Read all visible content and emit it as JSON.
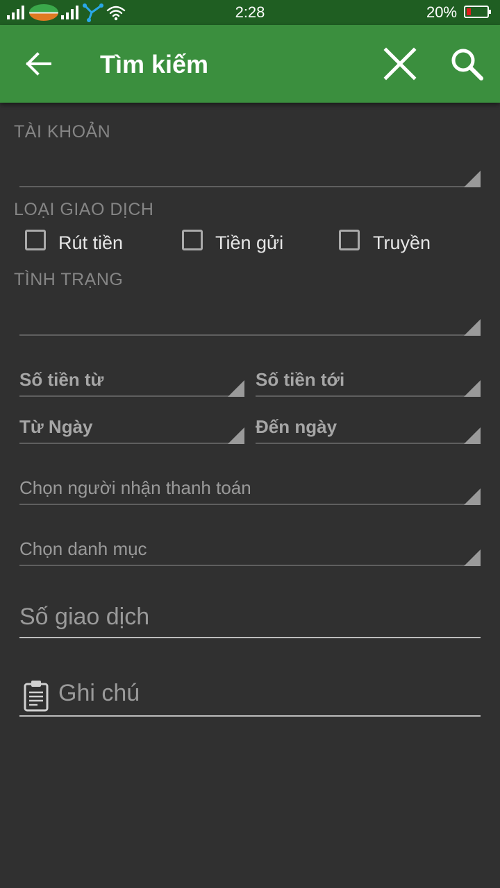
{
  "status_bar": {
    "time": "2:28",
    "battery_percent": "20%",
    "battery_level": 0.2,
    "icons": [
      "signal-icon",
      "carrier-logo",
      "signal-icon",
      "network-share-icon",
      "wifi-icon",
      "battery-icon"
    ]
  },
  "app_bar": {
    "title": "Tìm kiếm",
    "icons": [
      "back-arrow-icon",
      "close-icon",
      "search-icon"
    ],
    "background_color": "#3b8f3e"
  },
  "form": {
    "account_label": "TÀI KHOẢN",
    "transaction_type_label": "LOẠI GIAO DỊCH",
    "transaction_types": [
      "Rút tiền",
      "Tiền gửi",
      "Truyền"
    ],
    "status_label": "TÌNH TRẠNG",
    "amount_from": "Số tiền từ",
    "amount_to": "Số tiền tới",
    "date_from": "Từ Ngày",
    "date_to": "Đến ngày",
    "payee_placeholder": "Chọn người nhận thanh toán",
    "category_placeholder": "Chọn danh mục",
    "transaction_number_placeholder": "Số giao dịch",
    "note_placeholder": "Ghi chú",
    "note_icon": "clipboard-icon"
  }
}
